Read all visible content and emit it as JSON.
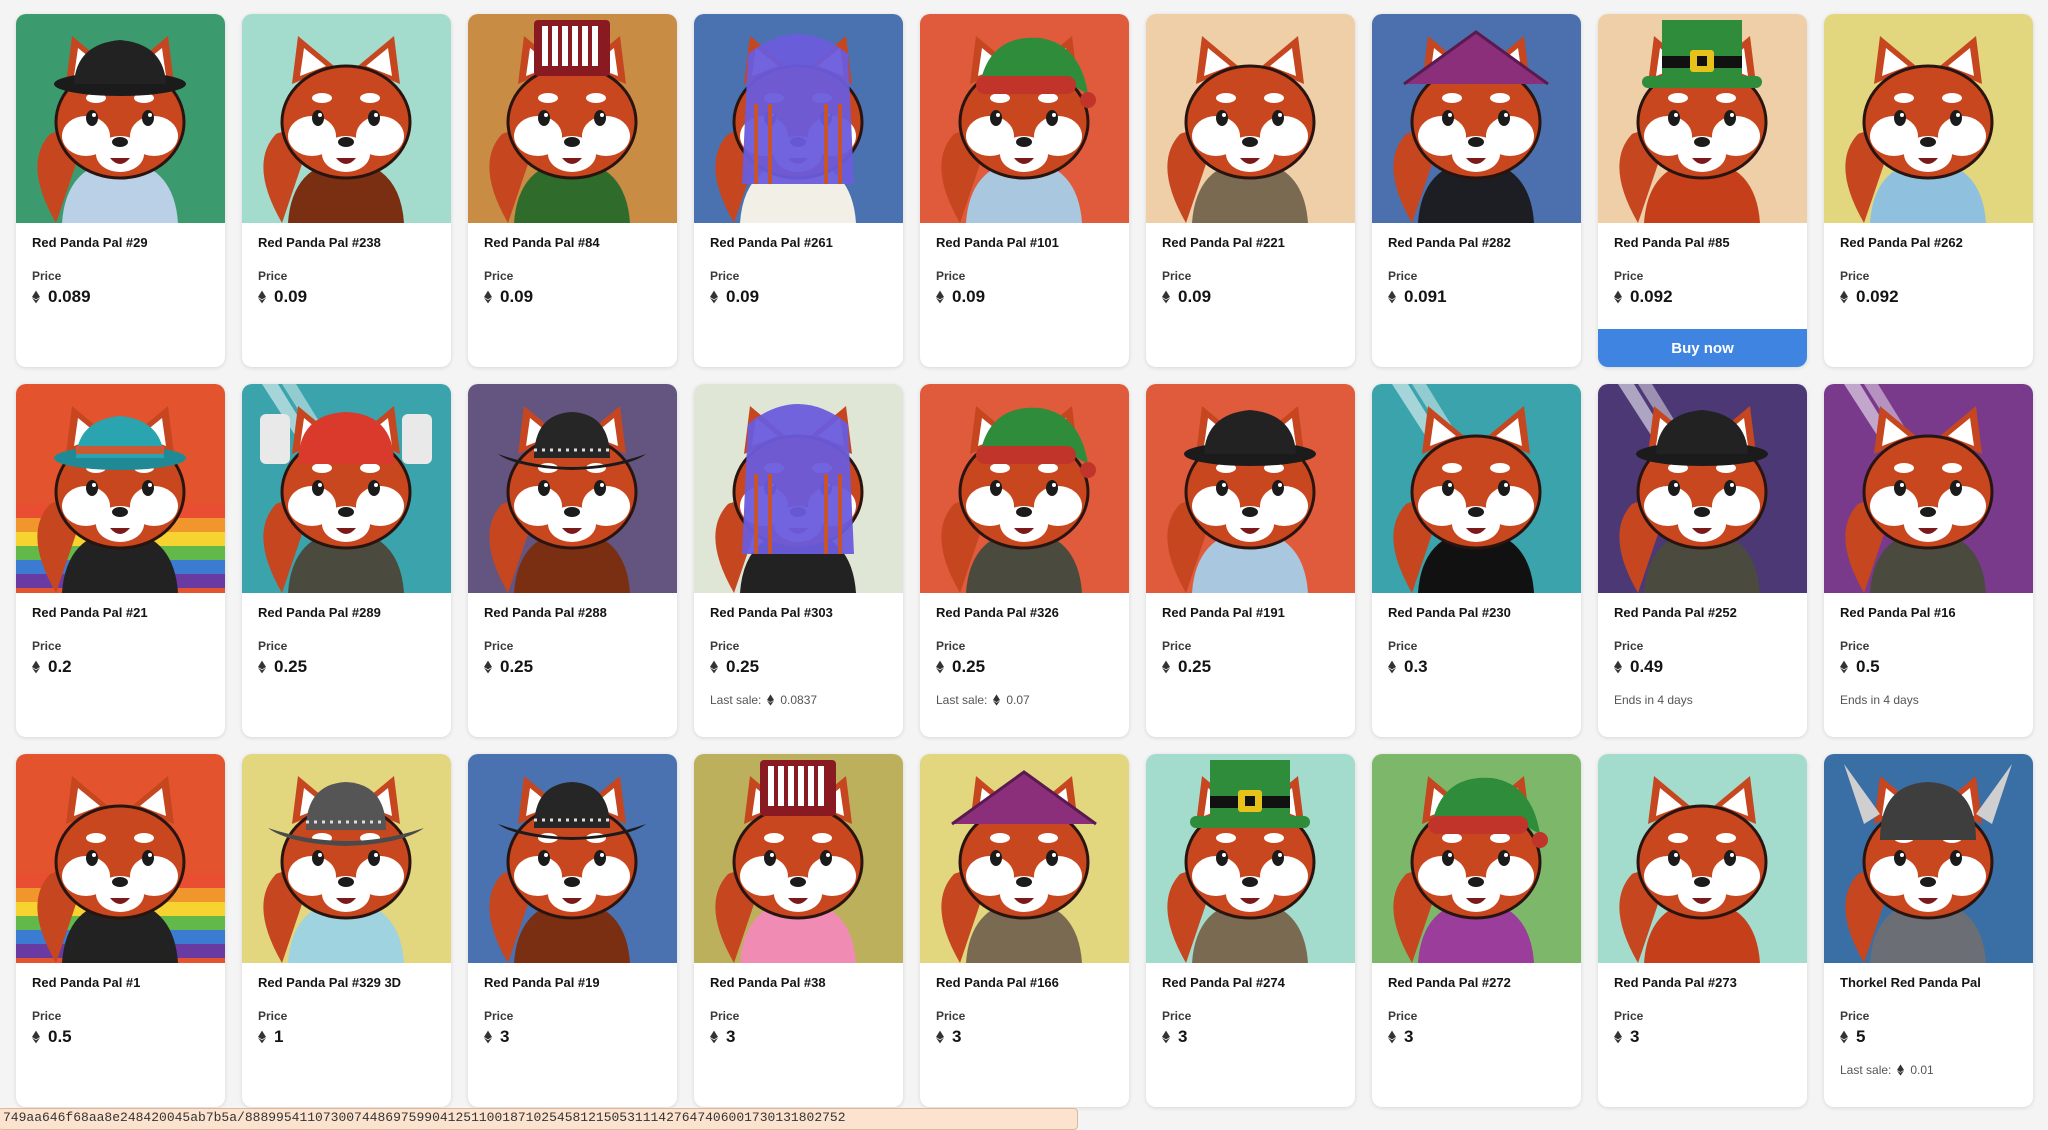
{
  "buy_now_label": "Buy now",
  "price_label": "Price",
  "status_url": "749aa646f68aa8e248420045ab7b5a/88899541107300744869759904125110018710254581215053111427647406001730131802752",
  "cards": [
    {
      "name": "Red Panda Pal #29",
      "price": "0.089",
      "bg": "#3b9b6e",
      "hat": "bucket-black",
      "shirt": "#b9d0e6"
    },
    {
      "name": "Red Panda Pal #238",
      "price": "0.09",
      "bg": "#a3dccd",
      "hat": "none",
      "shirt": "#7a2e12"
    },
    {
      "name": "Red Panda Pal #84",
      "price": "0.09",
      "bg": "#c98c45",
      "hat": "accordion",
      "shirt": "#2f6b2a"
    },
    {
      "name": "Red Panda Pal #261",
      "price": "0.09",
      "bg": "#4a72b0",
      "hat": "dreads",
      "shirt": "#f2efe6"
    },
    {
      "name": "Red Panda Pal #101",
      "price": "0.09",
      "bg": "#e05a3c",
      "hat": "elf",
      "shirt": "#a9c8e0"
    },
    {
      "name": "Red Panda Pal #221",
      "price": "0.09",
      "bg": "#eecfa8",
      "hat": "none",
      "shirt": "#7a6a52"
    },
    {
      "name": "Red Panda Pal #282",
      "price": "0.091",
      "bg": "#4b70ad",
      "hat": "conical",
      "shirt": "#1d1d24"
    },
    {
      "name": "Red Panda Pal #85",
      "price": "0.092",
      "bg": "#eecfa8",
      "hat": "leprechaun",
      "shirt": "#c63f1b",
      "buy": true
    },
    {
      "name": "Red Panda Pal #262",
      "price": "0.092",
      "bg": "#e2d67e",
      "hat": "none",
      "shirt": "#8fc0de"
    },
    {
      "name": "Red Panda Pal #21",
      "price": "0.2",
      "bg": "#e3542e",
      "hat": "bucket-teal",
      "shirt": "#222",
      "rainbow": true
    },
    {
      "name": "Red Panda Pal #289",
      "price": "0.25",
      "bg": "#3aa3ab",
      "hat": "helmet-red",
      "shirt": "#4a4b3e",
      "laser": true
    },
    {
      "name": "Red Panda Pal #288",
      "price": "0.25",
      "bg": "#63557f",
      "hat": "cowboy",
      "shirt": "#7a2e12"
    },
    {
      "name": "Red Panda Pal #303",
      "price": "0.25",
      "bg": "#dfe6d5",
      "hat": "dreads",
      "shirt": "#222",
      "last_sale_label": "Last sale:",
      "last_sale": "0.0837"
    },
    {
      "name": "Red Panda Pal #326",
      "price": "0.25",
      "bg": "#e05a3c",
      "hat": "elf",
      "shirt": "#4a4b3e",
      "last_sale_label": "Last sale:",
      "last_sale": "0.07"
    },
    {
      "name": "Red Panda Pal #191",
      "price": "0.25",
      "bg": "#e05a3c",
      "hat": "bucket-black",
      "shirt": "#a9c8e0"
    },
    {
      "name": "Red Panda Pal #230",
      "price": "0.3",
      "bg": "#3aa3ab",
      "hat": "none",
      "shirt": "#111",
      "laser": true
    },
    {
      "name": "Red Panda Pal #252",
      "price": "0.49",
      "bg": "#4b3875",
      "hat": "bucket-black",
      "shirt": "#4a4b3e",
      "laser": true,
      "ends": "Ends in 4 days"
    },
    {
      "name": "Red Panda Pal #16",
      "price": "0.5",
      "bg": "#7a3a8c",
      "hat": "none",
      "shirt": "#4a4b3e",
      "laser": true,
      "ends": "Ends in 4 days"
    },
    {
      "name": "Red Panda Pal #1",
      "price": "0.5",
      "bg": "#e3542e",
      "hat": "none",
      "shirt": "#222",
      "rainbow": true
    },
    {
      "name": "Red Panda Pal #329 3D",
      "price": "1",
      "bg": "#e2d67e",
      "hat": "cowboy-grey",
      "shirt": "#9fd3e0"
    },
    {
      "name": "Red Panda Pal #19",
      "price": "3",
      "bg": "#4a72b0",
      "hat": "cowboy",
      "shirt": "#7a2e12"
    },
    {
      "name": "Red Panda Pal #38",
      "price": "3",
      "bg": "#bdb05c",
      "hat": "accordion",
      "shirt": "#f08cb4"
    },
    {
      "name": "Red Panda Pal #166",
      "price": "3",
      "bg": "#e2d67e",
      "hat": "conical",
      "shirt": "#7a6a52"
    },
    {
      "name": "Red Panda Pal #274",
      "price": "3",
      "bg": "#a3dccd",
      "hat": "leprechaun",
      "shirt": "#7a6a52"
    },
    {
      "name": "Red Panda Pal #272",
      "price": "3",
      "bg": "#7db86a",
      "hat": "elf",
      "shirt": "#9b3d9b"
    },
    {
      "name": "Red Panda Pal #273",
      "price": "3",
      "bg": "#a3dccd",
      "hat": "none",
      "shirt": "#c63f1b"
    },
    {
      "name": "Thorkel Red Panda Pal",
      "price": "5",
      "bg": "#3a6fa5",
      "hat": "viking",
      "shirt": "#6b6f75",
      "last_sale_label": "Last sale:",
      "last_sale": "0.01"
    }
  ]
}
